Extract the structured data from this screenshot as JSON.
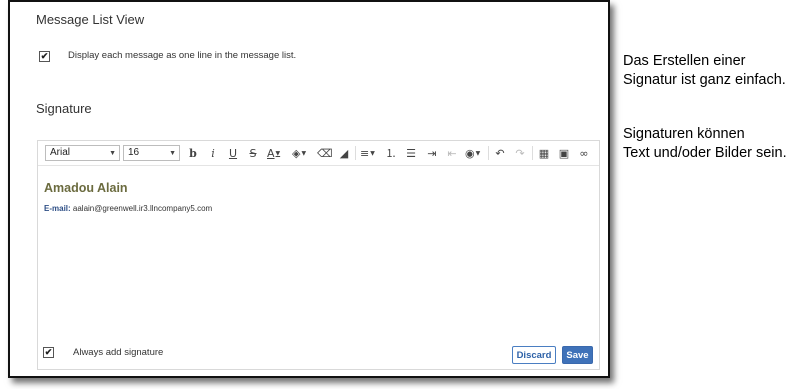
{
  "settings": {
    "message_list": {
      "title": "Message List View",
      "one_line_label": "Display each message as one line in the message list.",
      "one_line_checked": true
    },
    "signature": {
      "title": "Signature",
      "always_add_label": "Always add signature",
      "always_add_checked": true,
      "discard_label": "Discard",
      "save_label": "Save"
    }
  },
  "toolbar": {
    "font_value": "Arial",
    "size_value": "16",
    "icons": [
      "bold-icon",
      "italic-icon",
      "underline-icon",
      "strikethrough-icon",
      "font-color-icon",
      "highlight-color-icon",
      "clear-format-icon",
      "format-painter-icon",
      "align-icon",
      "numbered-list-icon",
      "bullet-list-icon",
      "indent-icon",
      "outdent-icon",
      "link-globe-icon",
      "undo-icon",
      "redo-icon",
      "table-icon",
      "image-icon",
      "link-icon"
    ]
  },
  "editor": {
    "name": "Amadou Alain",
    "email_label": "E-mail:",
    "email_value": "aalain@greenwell.ir3.llncompany5.com"
  },
  "annotations": {
    "line1": "Das Erstellen einer\nSignatur ist ganz einfach.",
    "line2": "Signaturen können\nText und/oder Bilder sein."
  },
  "colors": {
    "accent": "#3f72b9",
    "signature_name": "#6b6b3f",
    "email_label": "#2e4f86"
  }
}
